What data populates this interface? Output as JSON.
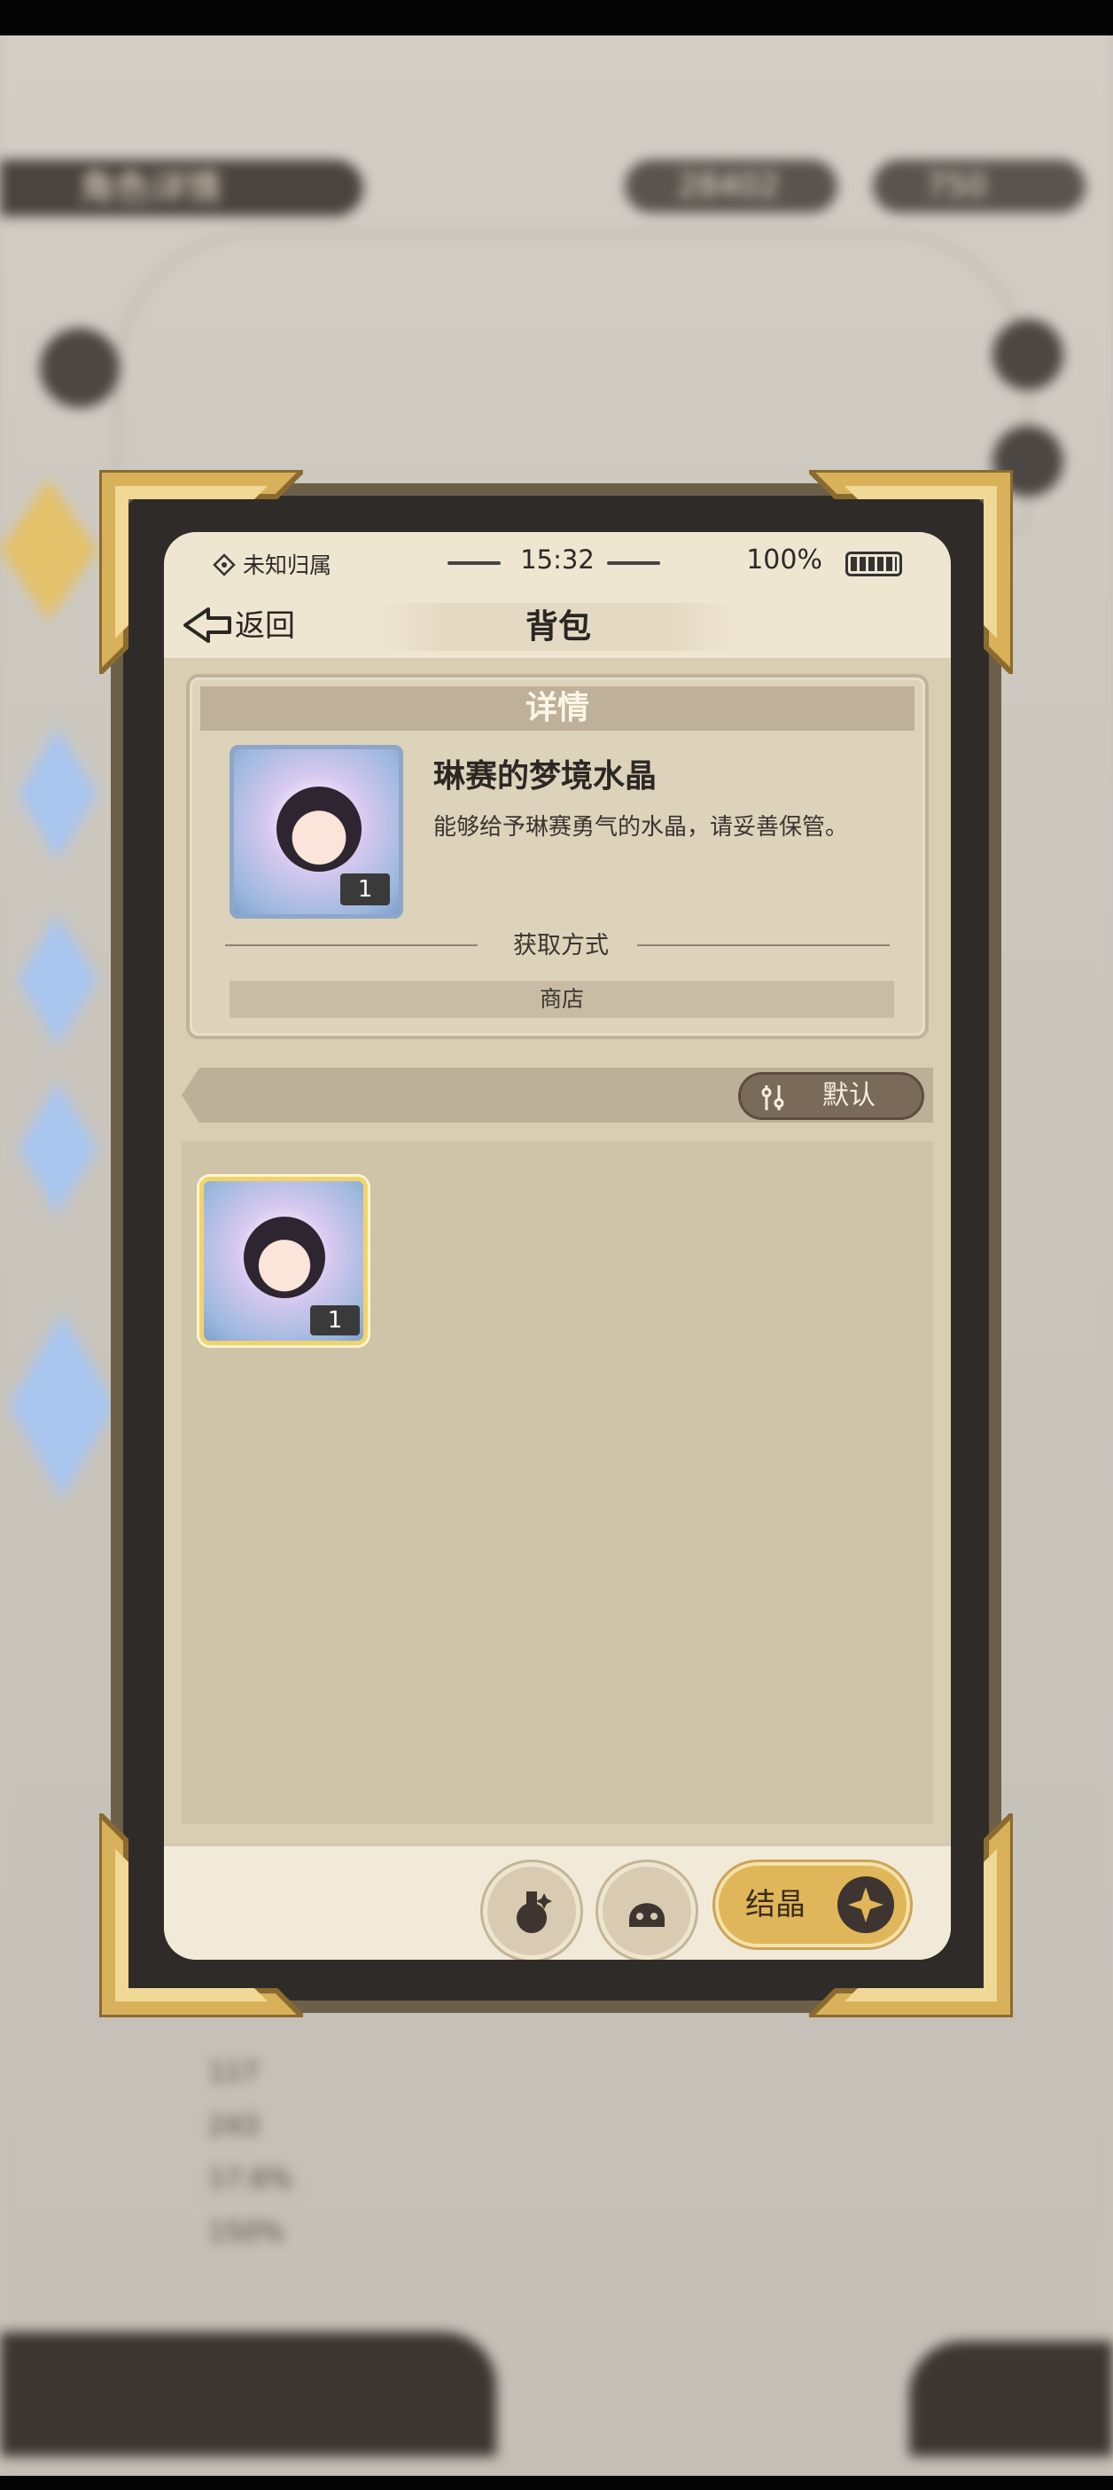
{
  "background": {
    "title": "角色详情",
    "currency1": "28402",
    "currency2": "750",
    "stats": [
      "117",
      "243",
      "17.6%",
      "150%"
    ]
  },
  "status": {
    "location": "未知归属",
    "time": "15:32",
    "battery": "100%"
  },
  "nav": {
    "back_label": "返回",
    "title": "背包"
  },
  "detail": {
    "header": "详情",
    "item_name": "琳赛的梦境水晶",
    "item_description": "能够给予琳赛勇气的水晶，请妥善保管。",
    "item_count": "1",
    "obtain_label": "获取方式",
    "obtain_source": "商店"
  },
  "sort": {
    "label": "默认"
  },
  "inventory": {
    "items": [
      {
        "count": "1",
        "icon": "dream-crystal-icon"
      }
    ]
  },
  "footer": {
    "crystal_label": "结晶"
  },
  "colors": {
    "accent_gold": "#e0b65a",
    "frame_dark": "#2f2b28",
    "panel_bg": "#d9cdb2"
  }
}
